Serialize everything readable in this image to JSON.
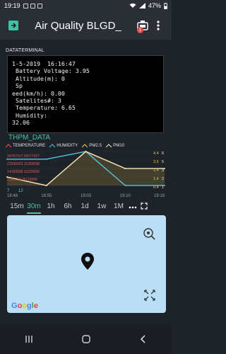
{
  "status": {
    "time": "19:19",
    "battery": "47%"
  },
  "header": {
    "title": "Air Quality BLGD_",
    "notification_count": "1"
  },
  "terminal": {
    "title": "DATATERMINAL",
    "text": "1-5-2019  16:16:47\n Battery Voltage: 3.95\n Altitude(m): 0\n Sp\need(km/h): 0.00\n Satelites#: 3\n Temperature: 6.65\n Humidity:\n32.06"
  },
  "chart": {
    "title": "THPM_DATA",
    "legend": [
      {
        "label": "TEMPERATURE",
        "color": "#e05a5a"
      },
      {
        "label": "HUMIDITY",
        "color": "#4cc7e6"
      },
      {
        "label": "PM2.5",
        "color": "#f0c24a"
      },
      {
        "label": "PM10",
        "color": "#f0e6b8"
      }
    ],
    "left_scale": [
      "28787017.20677057",
      "21590263.15359598",
      "14393508.10239936",
      "7196754.05119968"
    ],
    "left_top": "7",
    "left_bottom": "12",
    "right_scale": [
      "4.4",
      "3.5",
      "2.4",
      "1.4",
      "0.4"
    ],
    "right_scale_b": [
      "6",
      "5",
      "3",
      "2",
      "1"
    ],
    "x_ticks": [
      "18:48",
      "18:55",
      "19:03",
      "19:10",
      "19:18"
    ]
  },
  "chart_data": {
    "type": "line",
    "title": "THPM_DATA",
    "x": [
      "18:48",
      "18:55",
      "19:03",
      "19:10",
      "19:18"
    ],
    "series": [
      {
        "name": "TEMPERATURE",
        "values": [
          1.4,
          0.4,
          4.4,
          0.4,
          0.4
        ]
      },
      {
        "name": "HUMIDITY",
        "values": [
          3.5,
          3.5,
          4.4,
          0.4,
          0.4
        ]
      },
      {
        "name": "PM2.5",
        "values": [
          1.4,
          0.4,
          4.4,
          2.4,
          2.4
        ]
      },
      {
        "name": "PM10",
        "values": [
          1.4,
          0.4,
          4.4,
          2.4,
          2.4
        ]
      }
    ]
  },
  "time_tabs": [
    "15m",
    "30m",
    "1h",
    "6h",
    "1d",
    "1w",
    "1M"
  ],
  "active_tab": "30m",
  "map": {
    "logo": "Google"
  }
}
